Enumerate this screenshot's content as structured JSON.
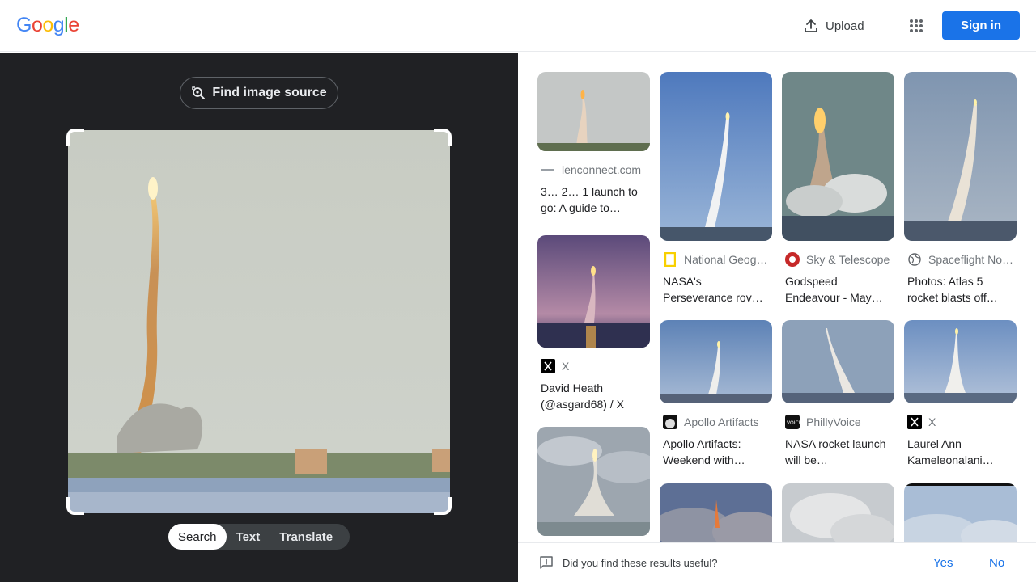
{
  "header": {
    "logo": [
      "G",
      "o",
      "o",
      "g",
      "l",
      "e"
    ],
    "logo_colors": [
      "#4285F4",
      "#EA4335",
      "#FBBC05",
      "#4285F4",
      "#34A853",
      "#EA4335"
    ],
    "upload_label": "Upload",
    "apps_icon": "apps-grid-icon",
    "signin_label": "Sign in",
    "accent": "#1a73e8"
  },
  "left": {
    "find_source_label": "Find image source",
    "find_source_icon": "lens-search-icon",
    "modes": [
      "Search",
      "Text",
      "Translate"
    ],
    "active_mode": "Search"
  },
  "results": [
    {
      "source": "lenconnect.com",
      "title": "3… 2… 1 launch to go: A guide to…",
      "icon": "site-dash-icon"
    },
    {
      "source": "X",
      "title": "David Heath (@asgard68) / X",
      "icon": "x-logo-icon"
    },
    {
      "source": "",
      "title": "",
      "icon": ""
    },
    {
      "source": "National Geog…",
      "title": "NASA's Perseverance rov…",
      "icon": "natgeo-icon"
    },
    {
      "source": "Apollo Artifacts",
      "title": "Apollo Artifacts: Weekend with…",
      "icon": "apollo-icon"
    },
    {
      "source": "",
      "title": "",
      "icon": ""
    },
    {
      "source": "Sky & Telescope",
      "title": "Godspeed Endeavour - May…",
      "icon": "sky-telescope-icon"
    },
    {
      "source": "PhillyVoice",
      "title": "NASA rocket launch will be…",
      "icon": "phillyvoice-icon"
    },
    {
      "source": "",
      "title": "",
      "icon": ""
    },
    {
      "source": "Spaceflight No…",
      "title": "Photos: Atlas 5 rocket blasts off…",
      "icon": "globe-icon"
    },
    {
      "source": "X",
      "title": "Laurel Ann Kameleonalani…",
      "icon": "x-logo-icon"
    },
    {
      "source": "",
      "title": "",
      "icon": ""
    }
  ],
  "feedback": {
    "question": "Did you find these results useful?",
    "icon": "feedback-icon",
    "yes": "Yes",
    "no": "No"
  }
}
